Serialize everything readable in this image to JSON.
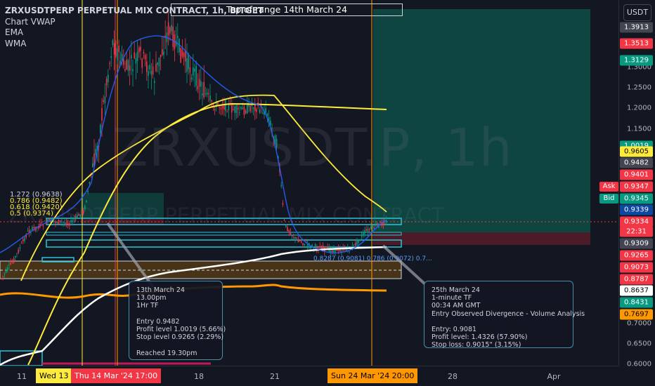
{
  "legend": {
    "symbol": "ZRXUSDTPERP PERPETUAL MIX CONTRACT, 1h, BITGET",
    "indicators": [
      "Chart VWAP",
      "EMA",
      "WMA"
    ]
  },
  "watermark": {
    "main": "ZRXUSDT.P, 1h",
    "sub": "ZRXUSDTPERP PERPETUAL MIX CONTRACT"
  },
  "top_note": "Top of range 14th March 24",
  "left_labels": [
    "1.272 (0.9638)",
    "0.786 (0.9482)",
    "0.618 (0.9420)",
    "0.5 (0.9374)"
  ],
  "bottom_numbers": "0.8287 (0.9081) 0.786 (0.9072) 0.7...",
  "annotation_left": {
    "lines": [
      "13th March 24",
      "13.00pm",
      "1Hr TF",
      "",
      "Entry 0.9482",
      "Profit level 1.0019 (5.66%)",
      "Stop level 0.9265 (2.29%)",
      "",
      "Reached 19.30pm"
    ]
  },
  "annotation_right": {
    "lines": [
      "25th March 24",
      "1-minute TF",
      "00:34 AM GMT",
      "Entry Observed Divergence - Volume Analysis",
      "",
      "Entry: 0.9081",
      "Profit level: 1.4326 (57.90%)",
      "Stop loss: 0.9015\" (3.15%)"
    ]
  },
  "currency_button": "USDT",
  "ask_label": "Ask",
  "bid_label": "Bid",
  "price_ticks": [
    "1.3000",
    "1.2500",
    "1.2000",
    "1.1500",
    "0.7000",
    "0.6500",
    "0.6000"
  ],
  "price_labels": [
    {
      "value": "1.3913",
      "bg": "#434651",
      "fg": "#ffffff"
    },
    {
      "value": "1.3513",
      "bg": "#f23645",
      "fg": "#ffffff"
    },
    {
      "value": "1.3129",
      "bg": "#089981",
      "fg": "#ffffff"
    },
    {
      "value": "1.0019",
      "bg": "#089981",
      "fg": "#ffffff"
    },
    {
      "value": "0.9605",
      "bg": "#ffeb3b",
      "fg": "#000000"
    },
    {
      "value": "0.9482",
      "bg": "#434651",
      "fg": "#ffffff"
    },
    {
      "value": "0.9401",
      "bg": "#f23645",
      "fg": "#ffffff"
    },
    {
      "value": "0.9347",
      "bg": "#f23645",
      "fg": "#ffffff"
    },
    {
      "value": "0.9345",
      "bg": "#089981",
      "fg": "#ffffff"
    },
    {
      "value": "0.9339",
      "bg": "#0d47a1",
      "fg": "#ffffff"
    },
    {
      "value": "0.9334",
      "bg": "#f23645",
      "fg": "#ffffff"
    },
    {
      "value": "22:31",
      "bg": "#f23645",
      "fg": "#ffffff"
    },
    {
      "value": "0.9309",
      "bg": "#434651",
      "fg": "#ffffff"
    },
    {
      "value": "0.9265",
      "bg": "#f23645",
      "fg": "#ffffff"
    },
    {
      "value": "0.9073",
      "bg": "#f23645",
      "fg": "#ffffff"
    },
    {
      "value": "0.8787",
      "bg": "#f23645",
      "fg": "#ffffff"
    },
    {
      "value": "0.8637",
      "bg": "#ffffff",
      "fg": "#000000"
    },
    {
      "value": "0.8431",
      "bg": "#089981",
      "fg": "#ffffff"
    },
    {
      "value": "0.7697",
      "bg": "#ff9800",
      "fg": "#000000"
    }
  ],
  "time_ticks": [
    "11",
    "18",
    "21",
    "28",
    "Apr"
  ],
  "time_labels": [
    {
      "text": "Wed 13",
      "bg": "#ffeb3b",
      "fg": "#000000"
    },
    {
      "text": "Thu 14 Mar '24   17:00",
      "bg": "#f23645",
      "fg": "#ffffff"
    },
    {
      "text": "Sun 24 Mar '24   20:00",
      "bg": "#ff9800",
      "fg": "#000000"
    }
  ]
}
